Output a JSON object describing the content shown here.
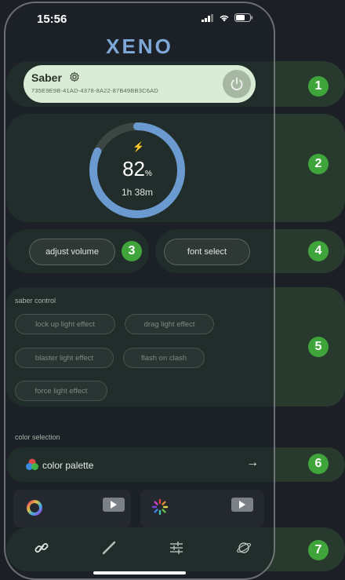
{
  "status": {
    "time": "15:56"
  },
  "brand": {
    "logo_text": "XENO"
  },
  "saber": {
    "name": "Saber",
    "id": "735E9E9B-41AD-4378-8A22-87B49BB3C6AD"
  },
  "battery": {
    "percent": "82",
    "percent_sign": "%",
    "duration": "1h 38m",
    "level": 0.82
  },
  "buttons": {
    "adjust_volume": "adjust volume",
    "font_select": "font select"
  },
  "saber_control": {
    "label": "saber control",
    "effects": [
      "lock up light effect",
      "drag light effect",
      "blaster light effect",
      "flash on clash",
      "force light effect"
    ]
  },
  "color_selection": {
    "label": "color selection",
    "palette_label": "color palette"
  },
  "callouts": [
    "1",
    "2",
    "3",
    "4",
    "5",
    "6",
    "7"
  ],
  "icons": {
    "settings": "gear-icon",
    "power": "power-icon",
    "arrow": "arrow-right-icon",
    "tabs": [
      "link-icon",
      "saber-blade-icon",
      "sliders-icon",
      "planet-icon"
    ]
  },
  "colors": {
    "accent": "#3fa53a",
    "ring": "#6b9ad0",
    "card": "#d9ecd6"
  }
}
